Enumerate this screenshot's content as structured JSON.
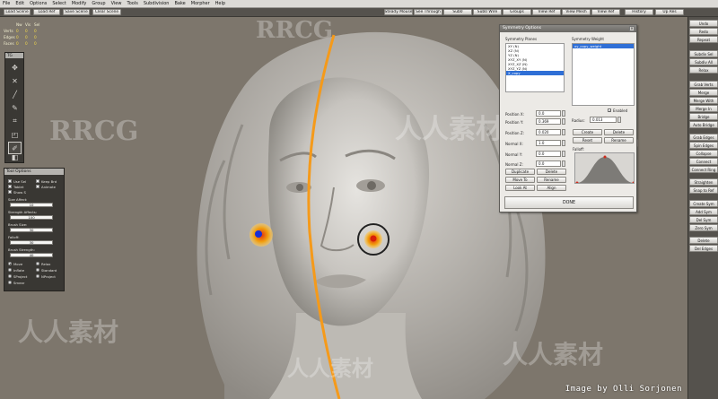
{
  "menubar": {
    "items": [
      "File",
      "Edit",
      "Options",
      "Select",
      "Modify",
      "Group",
      "View",
      "Tools",
      "Subdivision",
      "Bake",
      "Morpher",
      "Help"
    ]
  },
  "toolbar": {
    "buttons": [
      "Load Scene",
      "Load Ref",
      "Save Scene",
      "Clear Scene",
      "Steady Mouse",
      "See Through",
      "Sub0",
      "Sub0 Wire",
      "Groups",
      "View Ref",
      "View Mesh",
      "View Ref",
      "History",
      "Up Res"
    ]
  },
  "stats": {
    "headers": [
      "",
      "Nw",
      "Vis",
      "Sel"
    ],
    "rows": [
      {
        "label": "Verts",
        "v1": "0",
        "v2": "0",
        "v3": "0"
      },
      {
        "label": "Edges",
        "v1": "0",
        "v2": "0",
        "v3": "0"
      },
      {
        "label": "Faces",
        "v1": "0",
        "v2": "0",
        "v3": "0"
      }
    ]
  },
  "toolbox": {
    "title": "TG",
    "tools": [
      "move-tool-icon",
      "cross-tool-icon",
      "knife-tool-icon",
      "pen-tool-icon",
      "crop-tool-icon",
      "scale-tool-icon",
      "brush-tool-icon",
      "fill-tool-icon"
    ]
  },
  "tool_options": {
    "title": "Tool Options",
    "checks": [
      {
        "label": "Use Sel",
        "checked": false
      },
      {
        "label": "Keep Brd",
        "checked": false
      },
      {
        "label": "Tablet",
        "checked": false
      },
      {
        "label": "Animate",
        "checked": false
      },
      {
        "label": "Show S",
        "checked": false
      }
    ],
    "size_affect_label": "Size Affect:",
    "size_affect_value": "10",
    "strength_label": "Strength Affects:",
    "strength_value": "100",
    "brush_size_label": "Brush Size:",
    "brush_size_value": "30",
    "falloff_label": "Falloff:",
    "falloff_value": "30",
    "brush_strength_label": "Brush Strength:",
    "brush_strength_value": "40",
    "radios": [
      {
        "label": "Move",
        "on": true
      },
      {
        "label": "Relax",
        "on": false
      },
      {
        "label": "Inflate",
        "on": false
      },
      {
        "label": "Standard",
        "on": false
      },
      {
        "label": "SProject",
        "on": false
      },
      {
        "label": "NProject",
        "on": false
      },
      {
        "label": "Smear",
        "on": false
      }
    ]
  },
  "right_panel": {
    "buttons": [
      "Undo",
      "Redo",
      "Repeat",
      "Subdiv Sel",
      "Subdiv All",
      "Relax",
      "Grab Verts",
      "Merge",
      "Merge With",
      "Merge In",
      "Bridge",
      "Auto Bridge",
      "Grab Edges",
      "Spin Edges",
      "Collapse",
      "Connect",
      "Connect Ring",
      "Straighten",
      "Snap to Ref",
      "Create Sym",
      "Add Sym",
      "Del Sym",
      "Zero Sym",
      "Delete",
      "Del Edges"
    ]
  },
  "symmetry": {
    "title": "Symmetry Options",
    "planes_label": "Symmetry Planes",
    "weights_label": "Symmetry Weight",
    "planes": [
      "XY (N)",
      "XZ (N)",
      "YZ (N)",
      "XYZ_XY (N)",
      "XYZ_XZ (N)",
      "XYZ_YZ (N)",
      "X_copy"
    ],
    "selected_plane_index": 6,
    "weights": [
      "xy_copy_weight"
    ],
    "position_x_label": "Position X:",
    "position_x": "0.0",
    "position_y_label": "Position Y:",
    "position_y": "0.369",
    "position_z_label": "Position Z:",
    "position_z": "0.020",
    "normal_x_label": "Normal X:",
    "normal_x": "1.0",
    "normal_y_label": "Normal Y:",
    "normal_y": "0.0",
    "normal_z_label": "Normal Z:",
    "normal_z": "0.0",
    "enabled_label": "Enabled",
    "enabled": true,
    "radius_label": "Radius:",
    "radius": "0.013",
    "falloff_label": "Falloff:",
    "buttons_left": [
      "Duplicate",
      "Delete",
      "Move To",
      "Rename",
      "Look At",
      "Align"
    ],
    "buttons_right": [
      "Create",
      "Delete",
      "Reset",
      "Rename"
    ],
    "done_label": "DONE"
  },
  "colors": {
    "axis_line": "#f59a1a",
    "brush_dot": "#e8520c",
    "marker_blue": "#1a2fd6"
  },
  "watermarks": {
    "rrcg": "RRCG",
    "cn": "人人素材",
    "credit": "Image by Olli Sorjonen"
  }
}
